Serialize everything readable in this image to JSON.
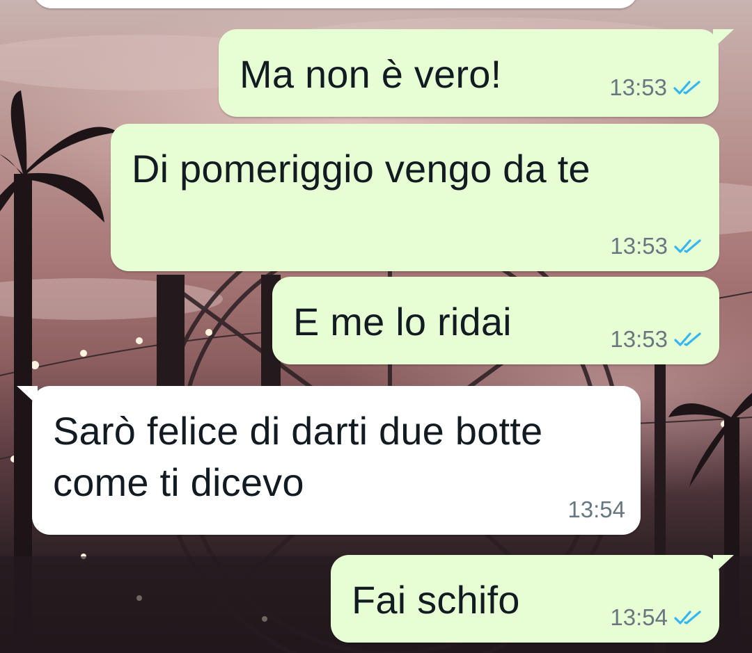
{
  "chat": {
    "messages": [
      {
        "text": "",
        "time": "",
        "direction": "incoming"
      },
      {
        "text": "Ma non è vero!",
        "time": "13:53",
        "direction": "outgoing",
        "status": "read"
      },
      {
        "text": "Di pomeriggio vengo da te",
        "time": "13:53",
        "direction": "outgoing",
        "status": "read"
      },
      {
        "text": "E me lo ridai",
        "time": "13:53",
        "direction": "outgoing",
        "status": "read"
      },
      {
        "text": "Sarò felice di darti due botte come ti dicevo",
        "time": "13:54",
        "direction": "incoming"
      },
      {
        "text": "Fai schifo",
        "time": "13:54",
        "direction": "outgoing",
        "status": "read"
      }
    ],
    "colors": {
      "outgoing_bubble": "#e7fdd3",
      "incoming_bubble": "#ffffff",
      "read_ticks": "#34b7f1",
      "meta_text": "#667781"
    }
  }
}
